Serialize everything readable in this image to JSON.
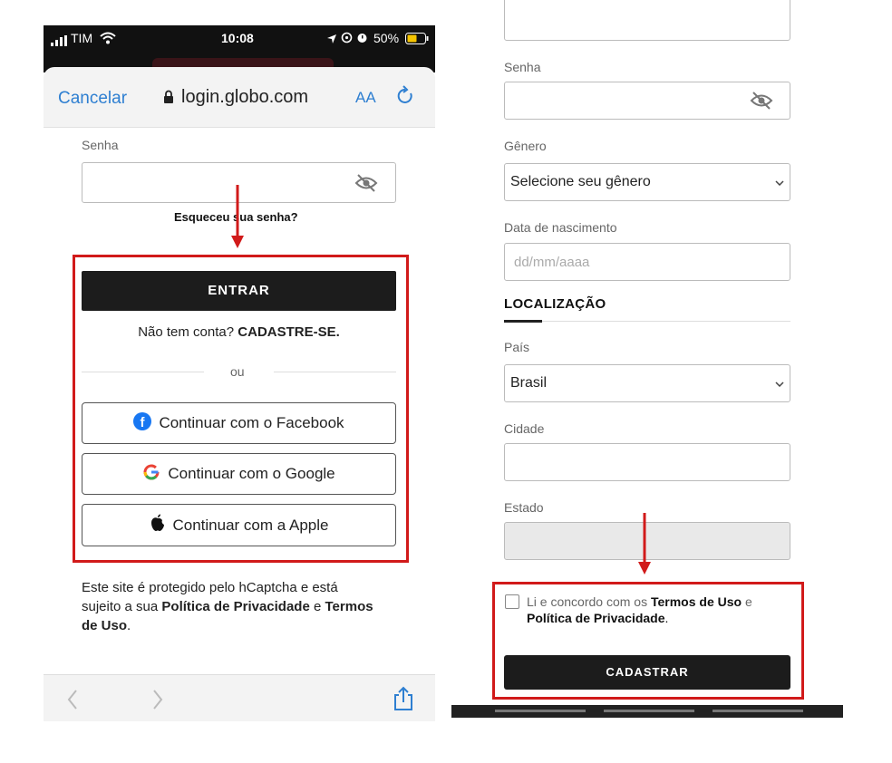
{
  "left": {
    "status": {
      "carrier": "TIM",
      "time": "10:08",
      "battery": "50%"
    },
    "browser": {
      "cancel": "Cancelar",
      "url": "login.globo.com",
      "text_size": "AA"
    },
    "password_label": "Senha",
    "forgot": "Esqueceu sua senha?",
    "enter_button": "ENTRAR",
    "no_account": "Não tem conta?",
    "signup_link": "CADASTRE-SE.",
    "or": "ou",
    "facebook_button": "Continuar com o Facebook",
    "google_button": "Continuar com o Google",
    "apple_button": "Continuar com a Apple",
    "captcha_text": "Este site é protegido pelo hCaptcha e está sujeito a sua",
    "privacy": "Política de Privacidade",
    "and": "e",
    "terms": "Termos de Uso",
    "period": "."
  },
  "right": {
    "password_label": "Senha",
    "gender_label": "Gênero",
    "gender_value": "Selecione seu gênero",
    "birth_label": "Data de nascimento",
    "birth_placeholder": "dd/mm/aaaa",
    "location_heading": "LOCALIZAÇÃO",
    "country_label": "País",
    "country_value": "Brasil",
    "city_label": "Cidade",
    "state_label": "Estado",
    "agree_prefix": "Li e concordo com os",
    "agree_terms": "Termos de Uso",
    "agree_and": "e",
    "agree_privacy": "Política de Privacidade",
    "agree_period": ".",
    "register_button": "CADASTRAR"
  },
  "colors": {
    "accent": "#2e7fd1",
    "highlight": "#d11a1a",
    "button": "#1c1c1c"
  }
}
